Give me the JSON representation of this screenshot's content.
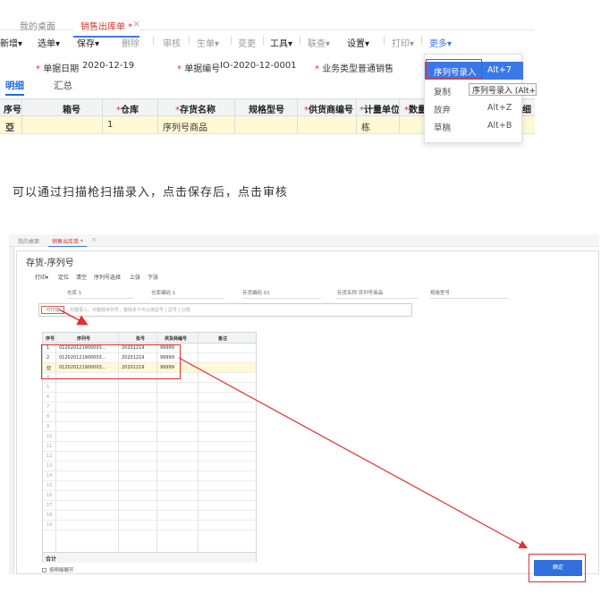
{
  "top": {
    "tab_home": "我的桌面",
    "tab_active": "销售出库单 *",
    "tab_close": "×",
    "toolbar": {
      "new": "新增",
      "select": "选单",
      "save": "保存",
      "delete": "删除",
      "audit": "审核",
      "generate": "生单",
      "change": "变更",
      "tools": "工具",
      "query": "联查",
      "settings": "设置",
      "print": "打印",
      "more": "更多",
      "sep": "|",
      "caret": "▾"
    },
    "fields": {
      "date_label": "单据日期",
      "date_value": "2020-12-19",
      "code_label": "单据编号",
      "code_value": "IO-2020-12-0001",
      "biztype_label": "业务类型",
      "biztype_value": "普通销售",
      "required_mark": "*"
    },
    "subtabs": {
      "detail": "明细",
      "summary": "汇总"
    },
    "grid": {
      "headers": [
        "序号",
        "箱号",
        "仓库",
        "存货名称",
        "规格型号",
        "供货商编号",
        "计量单位",
        "数量",
        "细"
      ],
      "row": {
        "seq_icon": "亞",
        "warehouse": "1",
        "item_name": "序列号商品",
        "unit": "栋"
      }
    },
    "dropdown": [
      {
        "label": "序列号录入",
        "shortcut": "Alt+7"
      },
      {
        "label": "复制",
        "shortcut": ""
      },
      {
        "label": "放弃",
        "shortcut": "Alt+Z"
      },
      {
        "label": "草稿",
        "shortcut": "Alt+B"
      }
    ],
    "tooltip": "序列号录入 (Alt+7"
  },
  "caption": "可以通过扫描枪扫描录入，点击保存后，点击审核",
  "dialog": {
    "tab_home": "我的桌面",
    "tab_active": "销售出库单 *",
    "tab_close": "×",
    "title": "存货-序列号",
    "toolbar": [
      "打印",
      "定位",
      "清空",
      "序列号选择",
      "上张",
      "下张"
    ],
    "fields": {
      "warehouse": "仓库 1",
      "warehouse_name": "仓库编码 1",
      "item_code": "存货编码 01",
      "item_name": "存货名称 序列号商品",
      "spec": "规格型号"
    },
    "scan_button": "可扫描",
    "scan_placeholder": "扫描录入，可删除序列号，删除多个可以用逗号 | 逗号 | 分隔",
    "grid": {
      "headers": [
        "序号",
        "序列号",
        "批号",
        "供货商编号",
        "备注"
      ],
      "rows": [
        {
          "seq": "1",
          "serial": "012020121900003...",
          "batch": "20201219",
          "supplier": "99999"
        },
        {
          "seq": "2",
          "serial": "012020121900003...",
          "batch": "20201219",
          "supplier": "99999"
        },
        {
          "seq": "亞",
          "serial": "012020121900003...",
          "batch": "20201219",
          "supplier": "99999"
        }
      ],
      "empty_row_numbers": [
        "4",
        "5",
        "6",
        "7",
        "8",
        "9",
        "10",
        "11",
        "12",
        "13",
        "14",
        "15",
        "16",
        "17",
        "18",
        "19"
      ],
      "footer": "合计"
    },
    "expand_label": "按明细展开",
    "ok_button": "确定"
  }
}
